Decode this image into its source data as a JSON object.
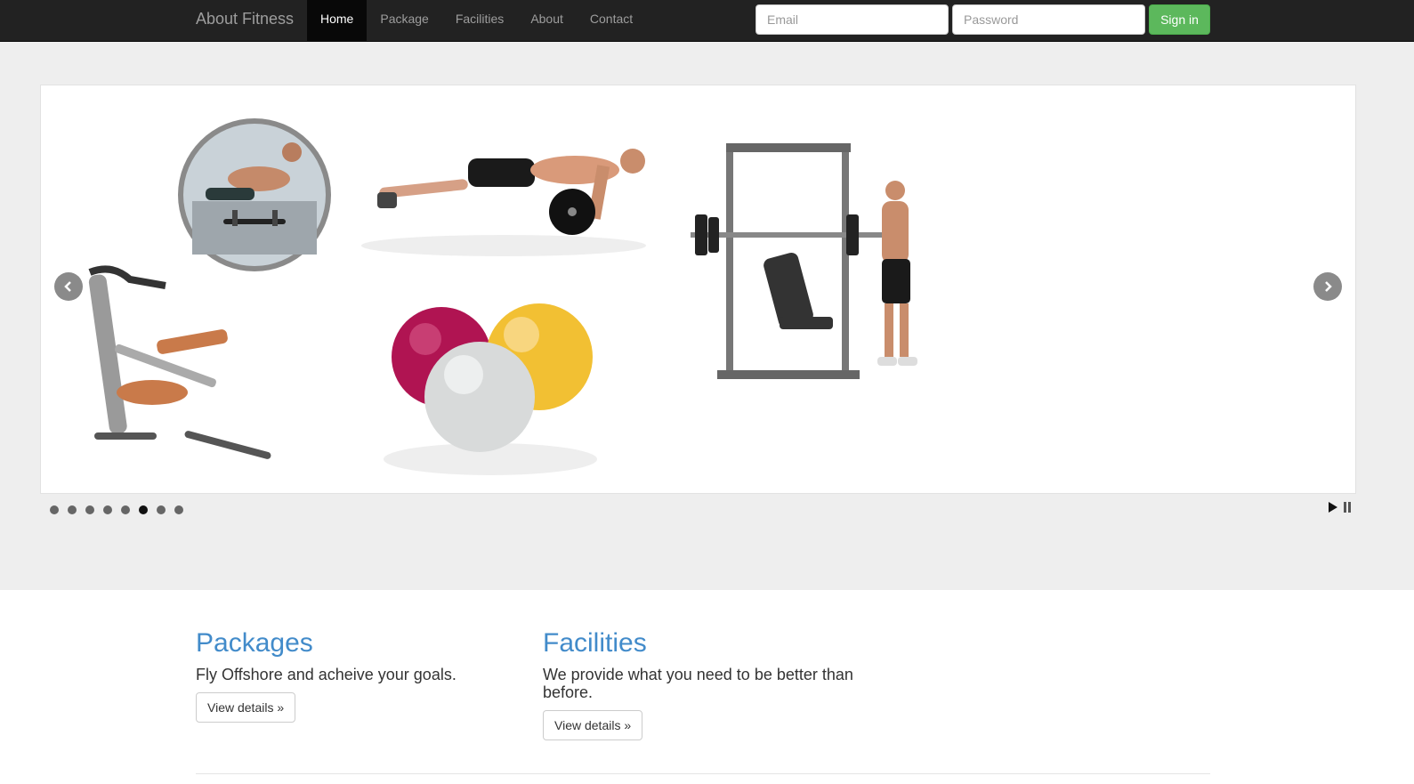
{
  "navbar": {
    "brand": "About Fitness",
    "items": [
      {
        "label": "Home",
        "active": true
      },
      {
        "label": "Package"
      },
      {
        "label": "Facilities"
      },
      {
        "label": "About"
      },
      {
        "label": "Contact"
      }
    ],
    "email_placeholder": "Email",
    "password_placeholder": "Password",
    "signin_label": "Sign in"
  },
  "slider": {
    "dots_count": 8,
    "active_dot": 6,
    "images": [
      "push-up-bars",
      "push-up-on-barbell",
      "exercise-bike",
      "exercise-balls",
      "smith-machine-gym"
    ]
  },
  "columns": [
    {
      "title": "Packages",
      "text": "Fly Offshore and acheive your goals.",
      "button": "View details »"
    },
    {
      "title": "Facilities",
      "text": "We provide what you need to be better than before.",
      "button": "View details »"
    }
  ],
  "colors": {
    "navbar": "#222222",
    "accent": "#428bca",
    "success": "#5cb85c",
    "jumbotron": "#eeeeee"
  }
}
